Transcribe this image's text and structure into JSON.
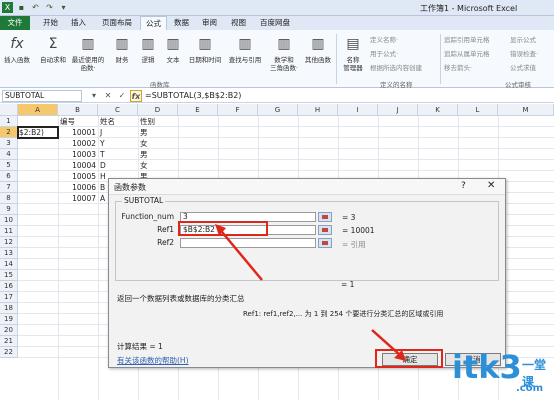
{
  "window": {
    "title": "工作簿1 - Microsoft Excel"
  },
  "tabs": [
    "文件",
    "开始",
    "插入",
    "页面布局",
    "公式",
    "数据",
    "审阅",
    "视图",
    "百度网盘"
  ],
  "active_tab": "公式",
  "ribbon": {
    "insert_function": "插入函数",
    "autosum": "自动求和",
    "recent": "最近使用的",
    "recent2": "函数·",
    "finance": "财务",
    "logic": "逻辑",
    "text": "文本",
    "datetime": "日期和时间",
    "lookup": "查找与引用",
    "math": "数学和",
    "math2": "三角函数·",
    "other": "其他函数",
    "library_label": "函数库",
    "name_manager": "名称",
    "name_manager2": "管理器",
    "define_name": "定义名称·",
    "use_in_formula": "用于公式·",
    "create_from_sel": "根据所选内容创建",
    "defined_names_label": "定义的名称",
    "trace_precedents": "追踪引用单元格",
    "trace_dependents": "追踪从属单元格",
    "remove_arrows": "移去箭头·",
    "show_formulas": "显示公式",
    "error_check": "错误检查·",
    "eval_formula": "公式求值",
    "audit_label": "公式审核"
  },
  "formula_bar": {
    "name_box": "SUBTOTAL",
    "formula": "=SUBTOTAL(3,$B$2:B2)"
  },
  "columns": [
    "A",
    "B",
    "C",
    "D",
    "E",
    "F",
    "G",
    "H",
    "I",
    "J",
    "K",
    "L",
    "M"
  ],
  "rows": [
    "1",
    "2",
    "3",
    "4",
    "5",
    "6",
    "7",
    "8",
    "9",
    "10",
    "11",
    "12",
    "13",
    "14",
    "15",
    "16",
    "17",
    "18",
    "19",
    "20",
    "21",
    "22"
  ],
  "sheet": {
    "headers": [
      "编号",
      "姓名",
      "性别"
    ],
    "a2": "$2:B2)",
    "data": [
      {
        "id": "10001",
        "name": "J",
        "gender": "男"
      },
      {
        "id": "10002",
        "name": "Y",
        "gender": "女"
      },
      {
        "id": "10003",
        "name": "T",
        "gender": "男"
      },
      {
        "id": "10004",
        "name": "D",
        "gender": "女"
      },
      {
        "id": "10005",
        "name": "H",
        "gender": "男"
      },
      {
        "id": "10006",
        "name": "B",
        "gender": "女"
      },
      {
        "id": "10007",
        "name": "A",
        "gender": "男"
      }
    ]
  },
  "dialog": {
    "title": "函数参数",
    "help_q": "?",
    "close": "✕",
    "group": "SUBTOTAL",
    "labels": [
      "Function_num",
      "Ref1",
      "Ref2"
    ],
    "values": [
      "3",
      "$B$2:B2",
      ""
    ],
    "results": [
      "= 3",
      "= 10001",
      "= 引用"
    ],
    "total": "= 1",
    "description": "返回一个数据列表或数据库的分类汇总",
    "param_desc": "Ref1:  ref1,ref2,... 为 1 到 254 个要进行分类汇总的区域或引用",
    "calc_result": "计算结果 = 1",
    "help_link": "有关该函数的帮助(H)",
    "ok": "确定",
    "cancel": "取消"
  },
  "watermark": {
    "logo": "itk3",
    "suffix": ".com",
    "cn": "一堂课"
  },
  "colors": {
    "accent": "#1f7a3a",
    "highlight": "#e0261b",
    "watermark": "#2d8fd8"
  }
}
